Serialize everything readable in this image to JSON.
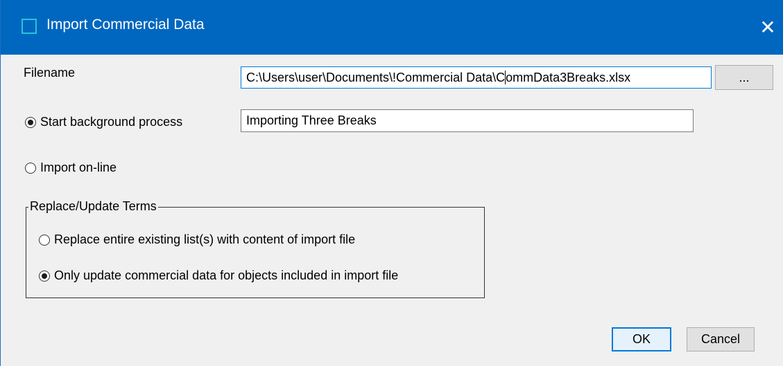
{
  "window": {
    "title": "Import Commercial Data",
    "close_glyph": "✕",
    "accent": "#0067c0"
  },
  "form": {
    "filename_label": "Filename",
    "filename_value": "C:\\Users\\user\\Documents\\!Commercial Data\\CommData3Breaks.xlsx",
    "filename_before_caret": "C:\\Users\\user\\Documents\\!Commercial Data\\C",
    "filename_after_caret": "ommData3Breaks.xlsx",
    "browse_label": "...",
    "start_bg_label": "Start background process",
    "start_bg_checked": true,
    "process_name_value": "Importing Three Breaks",
    "import_online_label": "Import on-line",
    "import_online_checked": false
  },
  "group": {
    "title": "Replace/Update Terms",
    "replace_label": "Replace entire existing list(s) with content of import file",
    "replace_checked": false,
    "update_label": "Only update commercial data for objects included in import file",
    "update_checked": true
  },
  "buttons": {
    "ok_label": "OK",
    "cancel_label": "Cancel"
  }
}
